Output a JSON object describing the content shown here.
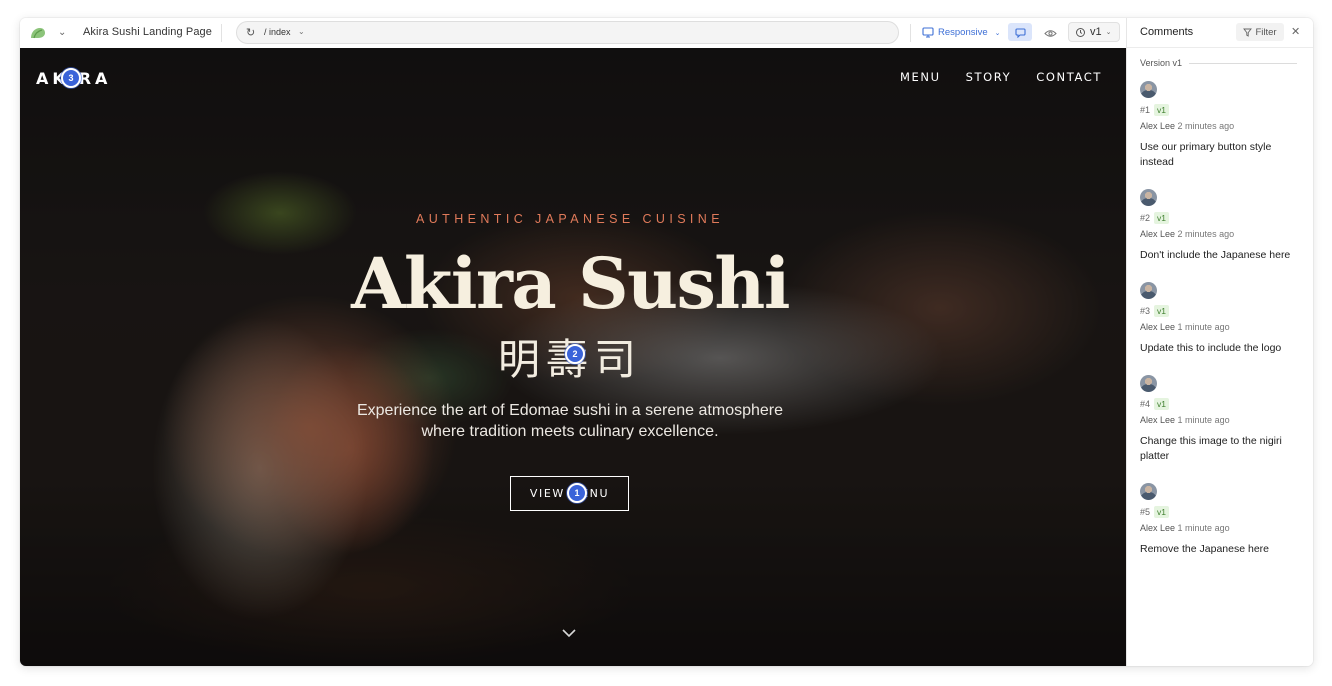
{
  "toolbar": {
    "project_title": "Akira Sushi Landing Page",
    "url_path": "/ index",
    "responsive_label": "Responsive",
    "version_label": "v1",
    "accent_color": "#3d6fd6"
  },
  "site": {
    "logo": "AKIRA",
    "nav": [
      "MENU",
      "STORY",
      "CONTACT"
    ],
    "eyebrow": "AUTHENTIC JAPANESE CUISINE",
    "title": "Akira Sushi",
    "japanese": "明壽司",
    "description": "Experience the art of Edomae sushi in a serene atmosphere where tradition meets culinary excellence.",
    "cta": "VIEW MENU",
    "eyebrow_color": "#e07a5a"
  },
  "pins": [
    {
      "number": "1"
    },
    {
      "number": "2"
    },
    {
      "number": "3"
    }
  ],
  "panel": {
    "title": "Comments",
    "filter_label": "Filter",
    "version_label": "Version v1",
    "comments": [
      {
        "number": "#1",
        "version": "v1",
        "author": "Alex Lee",
        "time": "2 minutes ago",
        "text": "Use our primary button style instead"
      },
      {
        "number": "#2",
        "version": "v1",
        "author": "Alex Lee",
        "time": "2 minutes ago",
        "text": "Don't include the Japanese here"
      },
      {
        "number": "#3",
        "version": "v1",
        "author": "Alex Lee",
        "time": "1 minute ago",
        "text": "Update this to include the logo"
      },
      {
        "number": "#4",
        "version": "v1",
        "author": "Alex Lee",
        "time": "1 minute ago",
        "text": "Change this image to the nigiri platter"
      },
      {
        "number": "#5",
        "version": "v1",
        "author": "Alex Lee",
        "time": "1 minute ago",
        "text": "Remove the Japanese here"
      }
    ]
  }
}
